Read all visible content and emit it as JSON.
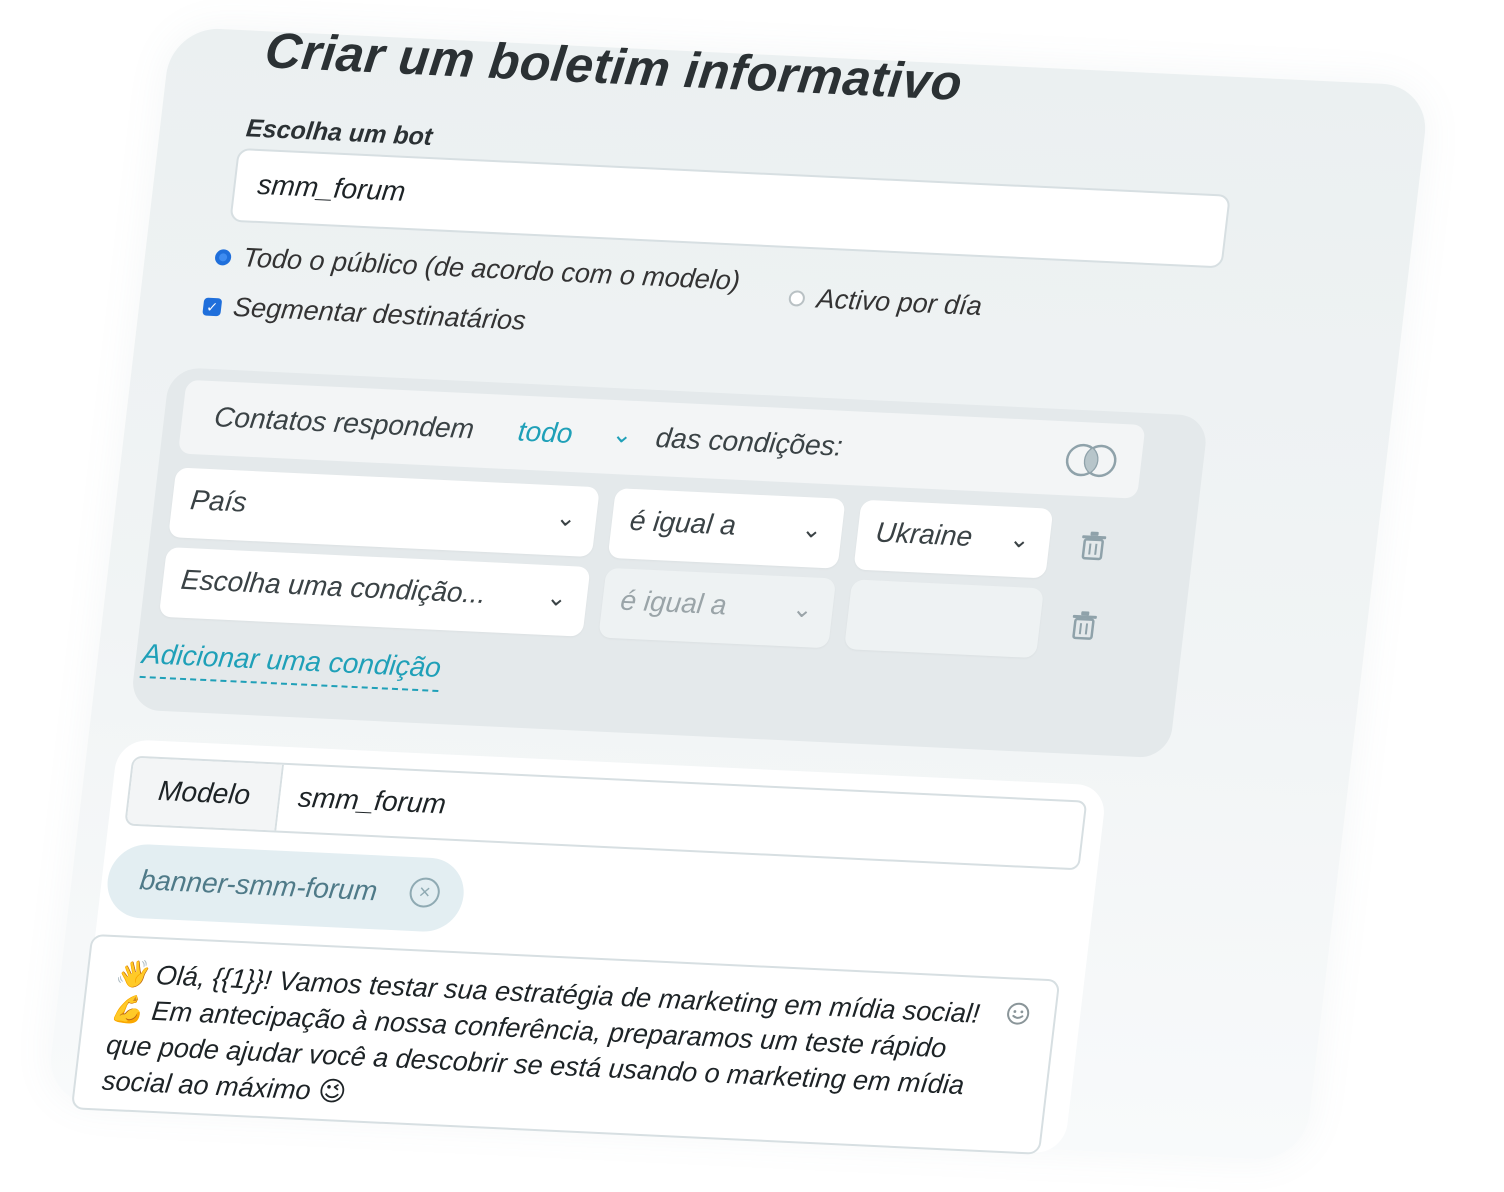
{
  "title": "Criar um boletim informativo",
  "bot": {
    "label": "Escolha um bot",
    "value": "smm_forum"
  },
  "audience": {
    "options": [
      {
        "label": "Todo o público (de acordo com o modelo)",
        "selected": true
      },
      {
        "label": "Activo por día",
        "selected": false
      }
    ],
    "segment": {
      "label": "Segmentar destinatários",
      "checked": true
    }
  },
  "conditions": {
    "prefix": "Contatos respondem",
    "mode": "todo",
    "suffix": "das condições:",
    "rows": [
      {
        "field": "País",
        "operator": "é igual a",
        "value": "Ukraine",
        "disabled": false
      },
      {
        "field": "Escolha uma condição...",
        "operator": "é igual a",
        "value": "",
        "disabled": true
      }
    ],
    "add_label": "Adicionar uma condição"
  },
  "template": {
    "label": "Modelo",
    "value": "smm_forum",
    "chip": "banner-smm-forum"
  },
  "message": {
    "text": "👋 Olá, {{1}}! Vamos testar sua estratégia de marketing em mídia social! 💪 Em antecipação à nossa conferência, preparamos um teste rápido que pode ajudar você a descobrir se está usando o marketing em mídia social ao máximo 😉"
  },
  "colors": {
    "accent": "#1fa0b8",
    "radio_blue": "#1f6fdb",
    "panel": "#e4e9eb"
  }
}
